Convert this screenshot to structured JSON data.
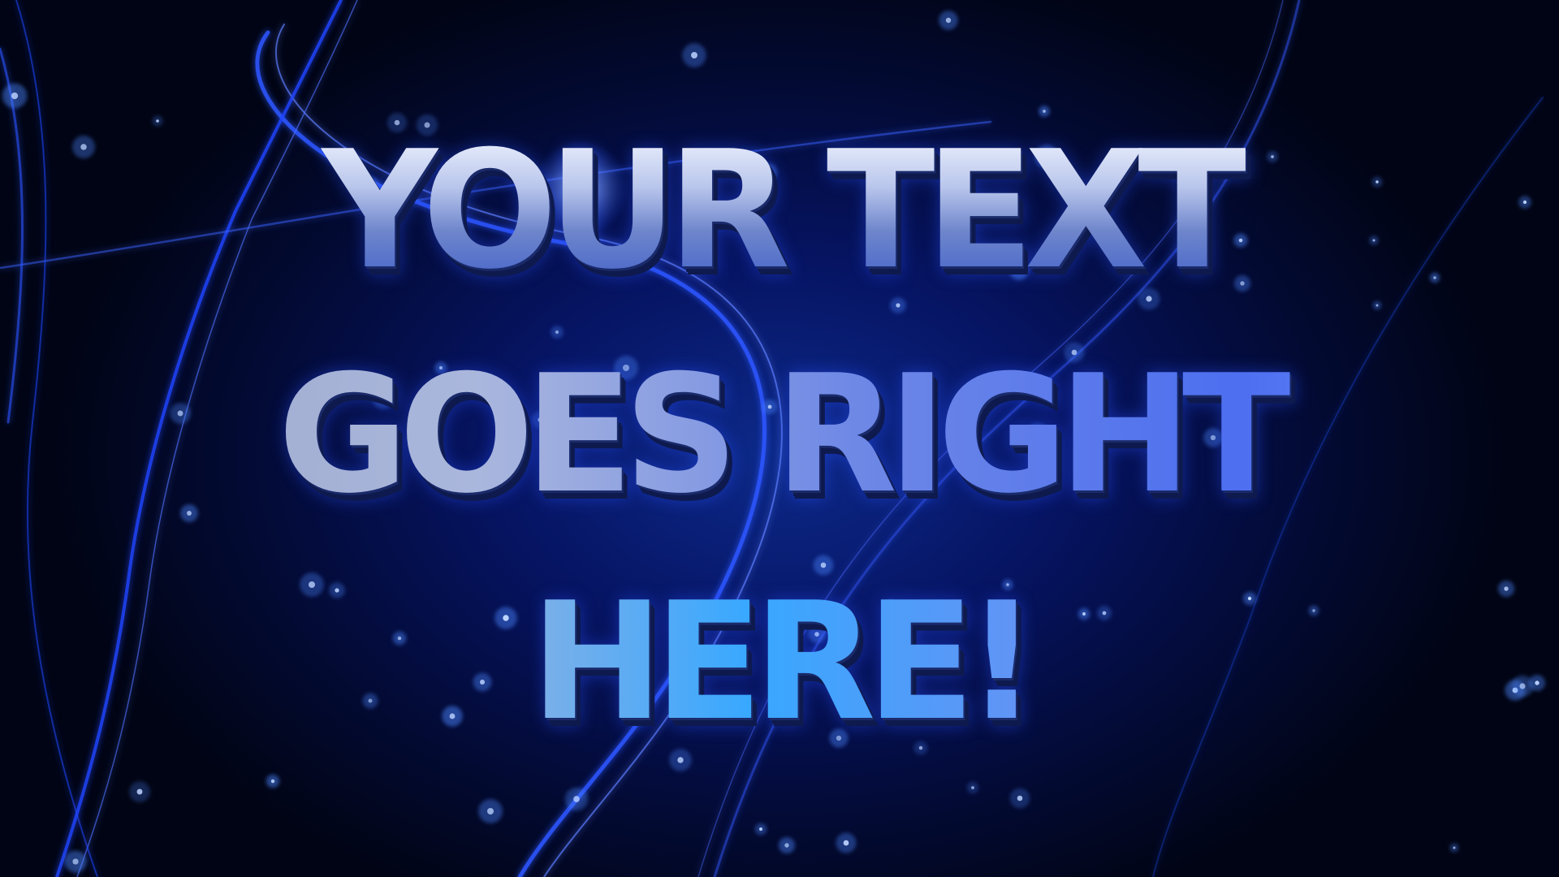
{
  "scene": {
    "headline": {
      "line1": "YOUR TEXT",
      "line2": "GOES RIGHT",
      "line3": "HERE!"
    },
    "colors": {
      "background_dark": "#02051a",
      "background_glow": "#0d2a8a",
      "light_streak": "#2e5bff",
      "particle": "#4b86ff",
      "text_highlight": "#f2f5ff",
      "text_blue": "#3f5fc8"
    },
    "particle_count": 70
  }
}
